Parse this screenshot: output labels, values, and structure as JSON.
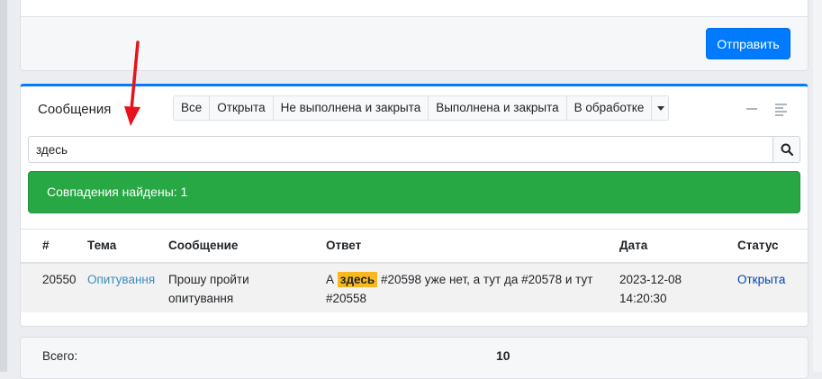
{
  "top_card": {
    "send_label": "Отправить"
  },
  "messages": {
    "title": "Сообщения",
    "filters": [
      "Все",
      "Открыта",
      "Не выполнена и закрыта",
      "Выполнена и закрыта",
      "В обработке"
    ],
    "search": {
      "value": "здесь",
      "placeholder": ""
    },
    "alert": "Совпадения найдены: 1",
    "columns": [
      "#",
      "Тема",
      "Сообщение",
      "Ответ",
      "Дата",
      "Статус"
    ],
    "rows": [
      {
        "id": "20550",
        "topic": "Опитування",
        "message_line1": "Прошу пройти",
        "message_line2": "опитування",
        "reply_pre": "А",
        "reply_highlight": "здесь",
        "reply_post": "#20598 уже нет, а тут да #20578 и тут",
        "reply_line2": "#20558",
        "date": "2023-12-08",
        "time": "14:20:30",
        "status": "Открыта"
      }
    ]
  },
  "footer": {
    "total_label": "Всего:",
    "total_value": "10"
  },
  "colors": {
    "accent": "#007bff",
    "success": "#28a745",
    "highlight": "#f9b81e",
    "annotation": "#e8121c"
  },
  "icons": {
    "search": "search-icon",
    "minimize": "minus-icon",
    "menu": "lines-icon",
    "annotation": "red-arrow"
  }
}
